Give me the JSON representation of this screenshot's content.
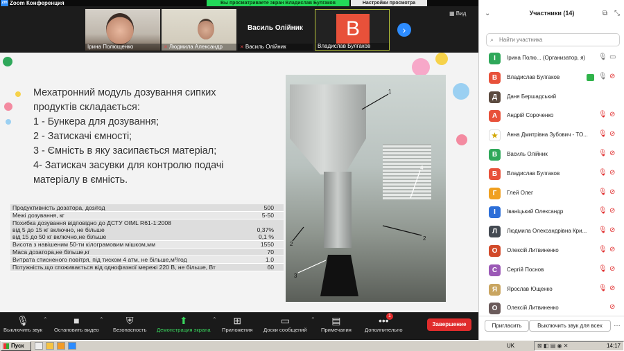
{
  "titlebar": {
    "title": "Zoom Конференция",
    "app_logo": "zm"
  },
  "share_banner": {
    "text": "Вы просматриваете экран Владислав Булгаков"
  },
  "view_options": {
    "label": "Настройки просмотра"
  },
  "video_strip": {
    "tiles": [
      {
        "name": "Ірина Полющенко",
        "muted": false
      },
      {
        "name": "Людмила Александр",
        "muted": true
      },
      {
        "name": "Василь Олійник",
        "muted": true,
        "big_name": "Василь Олійник"
      },
      {
        "name": "Владислав Булгаков",
        "muted": false,
        "avatar_letter": "B"
      }
    ],
    "view_label": "Вид"
  },
  "slide": {
    "heading_lines": [
      "Мехатронний модуль дозування сипких",
      "продуктів складається:",
      "1 - Бункера для дозування;",
      "2 - Затискачі ємності;",
      "3 - Ємність в яку засипається матеріал;",
      "4- Затискач засувки для контролю подачі",
      "матеріалу в ємність."
    ],
    "table": [
      {
        "label": "Продуктивність дозатора, доз/год",
        "value": "500"
      },
      {
        "label": "Межі дозування, кг",
        "value": "5-50"
      },
      {
        "label": "Похибка дозування відповідно до ДСТУ OIML R61-1:2008\nвід 5 до 15 кг включно, не більше\nвід 15 до 50 кг включно,не більше",
        "value": "\n0,37%\n0,1 %"
      },
      {
        "label": "Висота з навішеним 50-ти кілограмовим мішком,мм",
        "value": "1550"
      },
      {
        "label": "Маса дозатора,не більше,кг",
        "value": "70"
      },
      {
        "label": "Витрата стисненого повітря, під тиском 4 атм, не більше,м³/год",
        "value": "1.0"
      },
      {
        "label": "Потужність,що споживається від однофазної мережі 220 В, не більше, Вт",
        "value": "60"
      }
    ],
    "callouts": [
      "1",
      "4",
      "2",
      "2",
      "3"
    ]
  },
  "toolbar": {
    "items": [
      {
        "label": "Выключить звук",
        "icon": "mic-icon"
      },
      {
        "label": "Остановить видео",
        "icon": "video-icon"
      },
      {
        "label": "Безопасность",
        "icon": "shield-icon"
      },
      {
        "label": "Демонстрация экрана",
        "icon": "share-screen-icon"
      },
      {
        "label": "Приложения",
        "icon": "apps-icon"
      },
      {
        "label": "Доски сообщений",
        "icon": "whiteboard-icon"
      },
      {
        "label": "Примечания",
        "icon": "notes-icon"
      },
      {
        "label": "Дополнительно",
        "icon": "more-icon"
      }
    ],
    "more_badge": "1",
    "end_label": "Завершение"
  },
  "participants": {
    "title": "Участники (14)",
    "search_placeholder": "Найти участника",
    "list": [
      {
        "initial": "І",
        "name": "Ірина Полю...  (Организатор, я)",
        "color": "#2fa85a",
        "mic": "on",
        "cam": "none"
      },
      {
        "initial": "В",
        "name": "Владислав Булгаков",
        "color": "#e8513a",
        "mic": "on",
        "cam": "off",
        "video": true
      },
      {
        "initial": "Д",
        "name": "Даня Бершадський",
        "color": "#5b4a3f",
        "mic": "none",
        "cam": "none"
      },
      {
        "initial": "А",
        "name": "Андрій Сороченко",
        "color": "#e8513a",
        "mic": "off",
        "cam": "off"
      },
      {
        "initial": "★",
        "name": "Анна Дмитрівна Зубович - ТО...",
        "color": "#ffffff",
        "mic": "off",
        "cam": "off"
      },
      {
        "initial": "В",
        "name": "Василь Олійник",
        "color": "#2fa85a",
        "mic": "off",
        "cam": "off"
      },
      {
        "initial": "В",
        "name": "Владислав Булгаков",
        "color": "#e8513a",
        "mic": "off",
        "cam": "off"
      },
      {
        "initial": "Г",
        "name": "Глей Олег",
        "color": "#f0a020",
        "mic": "off",
        "cam": "off"
      },
      {
        "initial": "І",
        "name": "Іваніцький Олександр",
        "color": "#2d6fd8",
        "mic": "off",
        "cam": "off"
      },
      {
        "initial": "Л",
        "name": "Людмила Олександрівна Кри...",
        "color": "#444a52",
        "mic": "off",
        "cam": "off"
      },
      {
        "initial": "О",
        "name": "Олексій Литвиненко",
        "color": "#d24a2a",
        "mic": "off",
        "cam": "off"
      },
      {
        "initial": "С",
        "name": "Сергій Поснов",
        "color": "#9b59b6",
        "mic": "off",
        "cam": "off"
      },
      {
        "initial": "Я",
        "name": "Ярослав Ющенко",
        "color": "#c9a560",
        "mic": "off",
        "cam": "off"
      },
      {
        "initial": "О",
        "name": "Олексій Литвиненко",
        "color": "#6a5a5a",
        "mic": "none",
        "cam": "off"
      }
    ],
    "invite_label": "Пригласить",
    "mute_all_label": "Выключить звук для всех"
  },
  "taskbar": {
    "start_label": "Пуск",
    "tray_lang": "UK",
    "clock": "14:17"
  }
}
